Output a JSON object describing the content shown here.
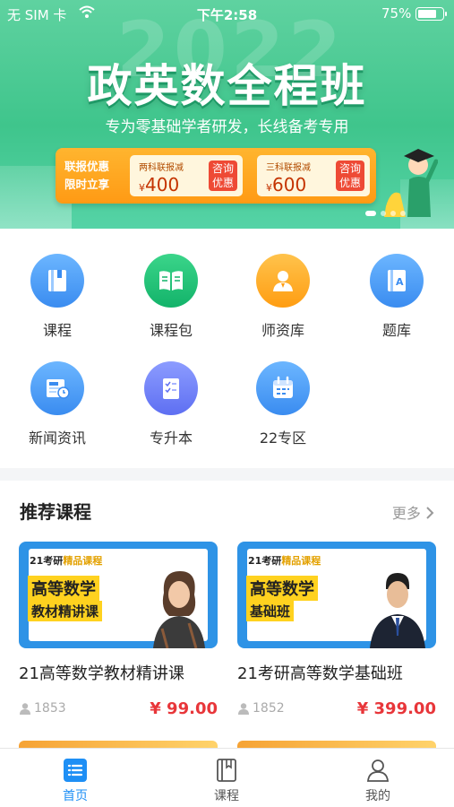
{
  "status_bar": {
    "carrier": "无 SIM 卡",
    "time": "下午2:58",
    "battery_pct": "75%",
    "battery_level": 0.75
  },
  "banner": {
    "bg_year": "2022",
    "title": "政英数全程班",
    "subtitle": "专为零基础学者研发，长线备考专用",
    "promo_label_1": "联报优惠",
    "promo_label_2": "限时立享",
    "coupons": [
      {
        "title": "两科联报减",
        "currency": "¥",
        "amount": "400",
        "cta_1": "咨询",
        "cta_2": "优惠"
      },
      {
        "title": "三科联报减",
        "currency": "¥",
        "amount": "600",
        "cta_1": "咨询",
        "cta_2": "优惠"
      }
    ],
    "carousel_pages": 4,
    "carousel_active": 1
  },
  "menu": {
    "items": [
      {
        "label": "课程",
        "icon": "book-icon"
      },
      {
        "label": "课程包",
        "icon": "open-book-icon"
      },
      {
        "label": "师资库",
        "icon": "teacher-icon"
      },
      {
        "label": "题库",
        "icon": "question-bank-icon"
      },
      {
        "label": "新闻资讯",
        "icon": "news-icon"
      },
      {
        "label": "专升本",
        "icon": "checklist-icon"
      },
      {
        "label": "22专区",
        "icon": "calendar-icon"
      }
    ]
  },
  "recommend": {
    "title": "推荐课程",
    "more": "更多",
    "courses": [
      {
        "thumb_tag_a": "21考研",
        "thumb_tag_b": "精品课程",
        "thumb_line_1": "高等数学",
        "thumb_line_2": "教材精讲课",
        "name": "21高等数学教材精讲课",
        "views": "1853",
        "price": "¥ 99.00"
      },
      {
        "thumb_tag_a": "21考研",
        "thumb_tag_b": "精品课程",
        "thumb_line_1": "高等数学",
        "thumb_line_2": "基础班",
        "name": "21考研高等数学基础班",
        "views": "1852",
        "price": "¥ 399.00"
      }
    ]
  },
  "tabbar": {
    "tabs": [
      {
        "label": "首页",
        "icon": "home-list-icon",
        "active": true
      },
      {
        "label": "课程",
        "icon": "course-book-icon",
        "active": false
      },
      {
        "label": "我的",
        "icon": "profile-icon",
        "active": false
      }
    ]
  },
  "colors": {
    "banner_green": "#3fc58c",
    "accent_blue": "#1e8ff5",
    "price_red": "#e8363a",
    "promo_orange": "#ff9d12"
  }
}
